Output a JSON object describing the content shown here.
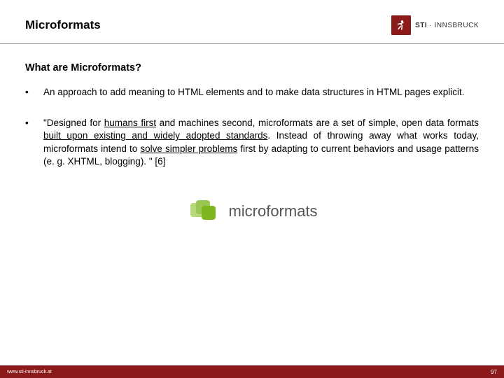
{
  "header": {
    "title": "Microformats",
    "logo_text_bold": "STI",
    "logo_text_sep": " · ",
    "logo_text_rest": "INNSBRUCK"
  },
  "content": {
    "subtitle": "What are Microformats?",
    "bullets": [
      {
        "marker": "•",
        "text": "An approach to add meaning to HTML elements and to make data structures in HTML pages explicit."
      },
      {
        "marker": "•",
        "pre": "\"Designed for ",
        "u1": "humans first",
        "mid1": " and machines second, microformats are a set of simple, open data formats ",
        "u2": "built upon existing and widely adopted standards",
        "mid2": ". Instead of throwing away what works today, microformats intend to ",
        "u3": "solve simpler problems",
        "post": " first by adapting to current behaviors and usage patterns (e. g. XHTML, blogging). \" [6]"
      }
    ]
  },
  "mf_logo": {
    "text": "microformats"
  },
  "footer": {
    "url": "www.sti-innsbruck.at",
    "page": "97"
  },
  "colors": {
    "brand": "#8b1a1a",
    "logo_green": "#7fb520"
  }
}
